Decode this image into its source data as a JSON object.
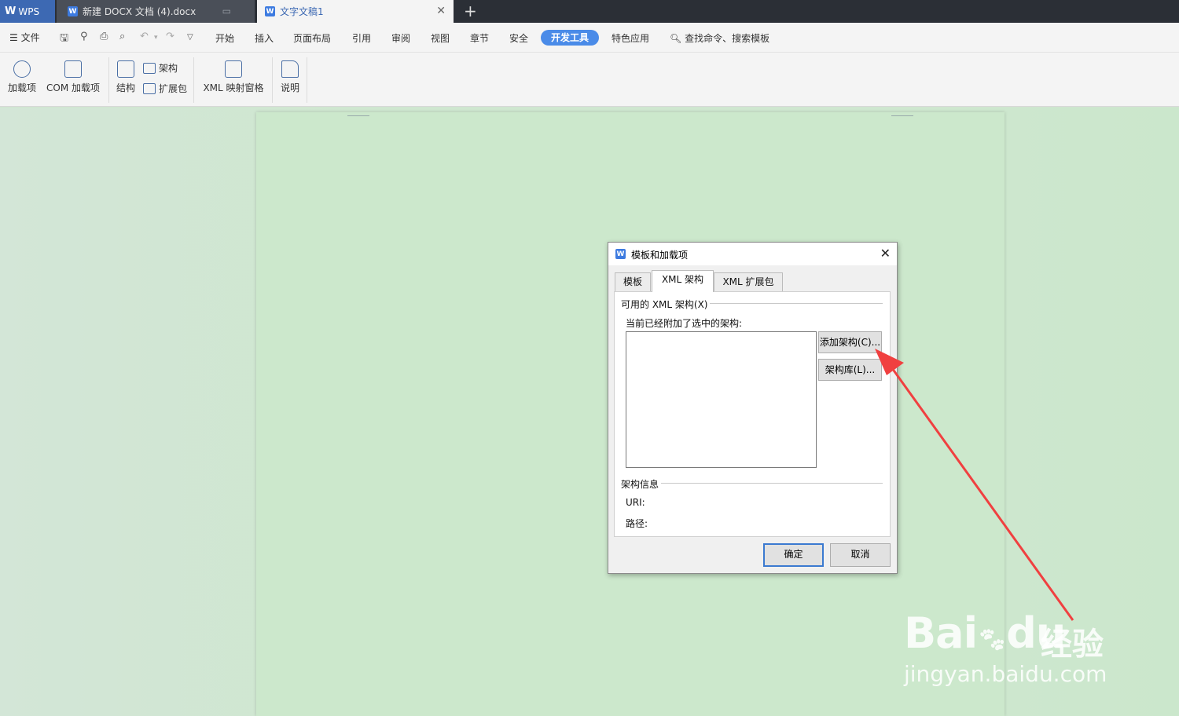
{
  "tabs": [
    {
      "label": "WPS"
    },
    {
      "label": "新建 DOCX 文档 (4).docx"
    },
    {
      "label": "文字文稿1"
    }
  ],
  "menu": {
    "file": "文件",
    "items": [
      "开始",
      "插入",
      "页面布局",
      "引用",
      "审阅",
      "视图",
      "章节",
      "安全"
    ],
    "active": "开发工具",
    "special": "特色应用",
    "search": "查找命令、搜索模板"
  },
  "ribbon": {
    "addins": "加载项",
    "com_addins": "COM 加载项",
    "structure": "结构",
    "schema": "架构",
    "expansion": "扩展包",
    "xml_pane": "XML 映射窗格",
    "help": "说明"
  },
  "dialog": {
    "title": "模板和加载项",
    "tabs": [
      "模板",
      "XML 架构",
      "XML 扩展包"
    ],
    "available_label": "可用的 XML 架构(X)",
    "attached_label": "当前已经附加了选中的架构:",
    "add_schema": "添加架构(C)...",
    "schema_library": "架构库(L)...",
    "info_label": "架构信息",
    "uri_label": "URI:",
    "path_label": "路径:",
    "ok": "确定",
    "cancel": "取消"
  },
  "colors": {
    "accent": "#4a8be8",
    "arrow": "#f04040",
    "page": "#cce8cc"
  },
  "watermark": {
    "brand": "Bai",
    "brand2": "du",
    "cn": "经验",
    "url": "jingyan.baidu.com"
  }
}
